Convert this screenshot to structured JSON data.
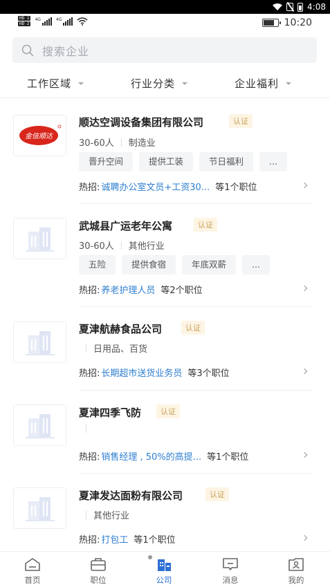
{
  "system_bar": {
    "time": "4:08"
  },
  "status_bar": {
    "hd1": "HD 1",
    "hd2": "HD 2",
    "net1": "4G",
    "net2": "4G",
    "time": "10:20"
  },
  "search": {
    "placeholder": "搜索企业"
  },
  "filters": [
    {
      "label": "工作区域"
    },
    {
      "label": "行业分类"
    },
    {
      "label": "企业福利"
    }
  ],
  "companies": [
    {
      "name": "顺达空调设备集团有限公司",
      "badge": "认证",
      "size": "30-60人",
      "industry": "制造业",
      "tags": [
        "晋升空间",
        "提供工装",
        "节日福利",
        "..."
      ],
      "hot_label": "热招:",
      "hot_job": "诚聘办公室文员+工资30...",
      "job_count": "等1个职位",
      "logo": "red-brand-logo",
      "logo_text": "金信顺达"
    },
    {
      "name": "武城县广运老年公寓",
      "badge": "认证",
      "size": "30-60人",
      "industry": "其他行业",
      "tags": [
        "五险",
        "提供食宿",
        "年底双薪",
        "..."
      ],
      "hot_label": "热招:",
      "hot_job": "养老护理人员",
      "job_count": "等2个职位",
      "logo": "building-placeholder"
    },
    {
      "name": "夏津航赫食品公司",
      "badge": "认证",
      "size": "",
      "industry": "日用品、百货",
      "tags": [],
      "hot_label": "热招:",
      "hot_job": "长期超市送货业务员",
      "job_count": "等3个职位",
      "logo": "building-placeholder"
    },
    {
      "name": "夏津四季飞防",
      "badge": "认证",
      "size": "",
      "industry": "",
      "tags": [],
      "hot_label": "热招:",
      "hot_job": "销售经理 , 50%的高提...",
      "job_count": "等1个职位",
      "logo": "building-placeholder"
    },
    {
      "name": "夏津发达面粉有限公司",
      "badge": "认证",
      "size": "",
      "industry": "其他行业",
      "tags": [],
      "hot_label": "热招:",
      "hot_job": "打包工",
      "job_count": "等1个职位",
      "logo": "building-placeholder"
    }
  ],
  "tabbar": [
    {
      "label": "首页",
      "icon": "home-icon"
    },
    {
      "label": "职位",
      "icon": "briefcase-icon"
    },
    {
      "label": "公司",
      "icon": "company-icon",
      "active": true
    },
    {
      "label": "消息",
      "icon": "message-icon"
    },
    {
      "label": "我的",
      "icon": "profile-icon"
    }
  ],
  "colors": {
    "accent": "#2e6fd6",
    "link": "#2e7fd1",
    "badge_text": "#c9a25a",
    "badge_bg": "#fdf4e3",
    "logo_red": "#d8261c"
  }
}
